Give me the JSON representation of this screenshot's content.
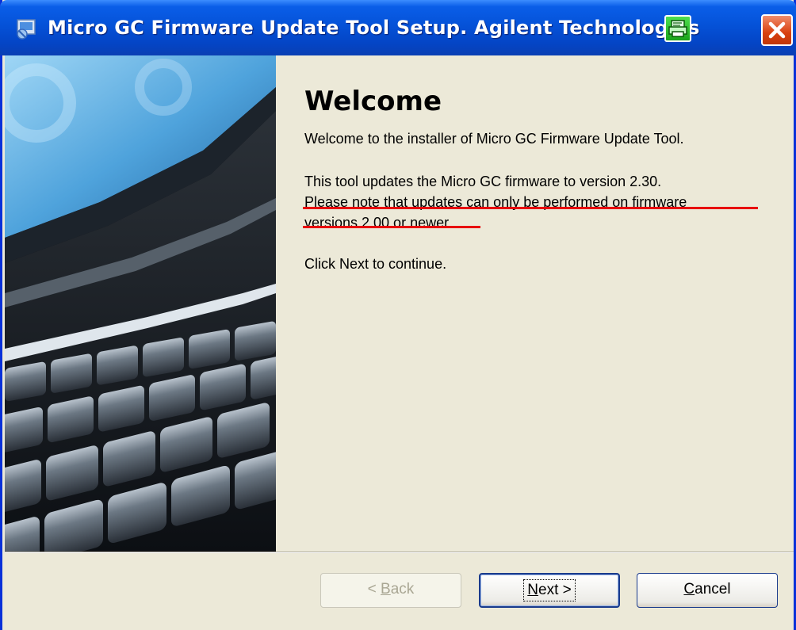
{
  "window": {
    "title": "Micro GC Firmware Update Tool Setup. Agilent Technologies"
  },
  "page": {
    "heading": "Welcome",
    "intro": "Welcome to the installer of Micro GC Firmware Update Tool.",
    "line1": "This tool updates the Micro GC firmware to version 2.30.",
    "line2": "Please note that updates can only be performed on firmware",
    "line3": "versions 2.00 or newer.",
    "line4": "Click Next to continue."
  },
  "buttons": {
    "back": {
      "prefix": "< ",
      "accel": "B",
      "rest": "ack",
      "enabled": false
    },
    "next": {
      "prefix": "",
      "accel": "N",
      "rest": "ext >",
      "enabled": true
    },
    "cancel": {
      "prefix": "",
      "accel": "C",
      "rest": "ancel",
      "enabled": true
    }
  },
  "icons": {
    "app": "installer-icon",
    "extra": "green-printer-icon",
    "close": "close-icon",
    "side": "laptop-keyboard-image"
  },
  "colors": {
    "titlebar": "#0552d8",
    "annotation_underline": "#e8000b",
    "dialog_bg": "#ece9d8"
  }
}
